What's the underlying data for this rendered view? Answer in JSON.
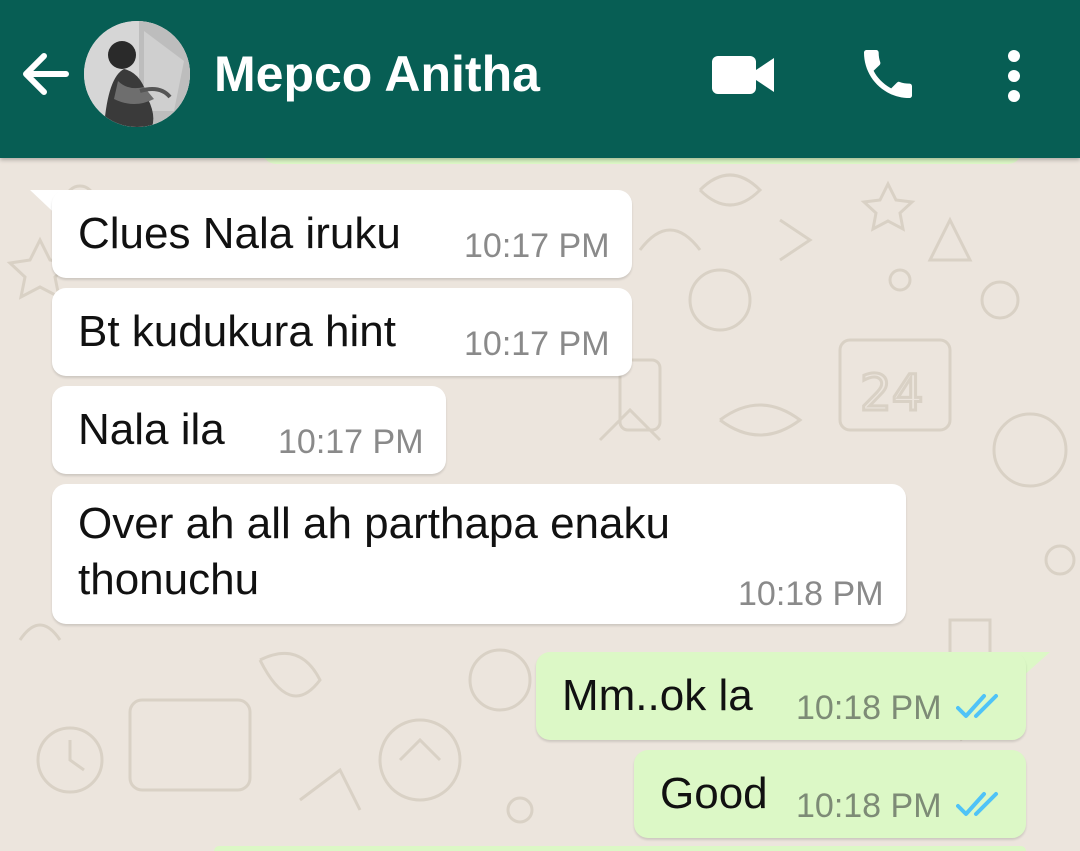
{
  "header": {
    "contact_name": "Mepco Anitha",
    "back_icon": "arrow-left-icon",
    "video_icon": "videocam-icon",
    "call_icon": "phone-icon",
    "menu_icon": "more-vert-icon",
    "background_color": "#075e54"
  },
  "messages": [
    {
      "direction": "incoming",
      "text": "Clues Nala iruku",
      "time": "10:17 PM"
    },
    {
      "direction": "incoming",
      "text": "Bt kudukura hint",
      "time": "10:17 PM"
    },
    {
      "direction": "incoming",
      "text": "Nala ila",
      "time": "10:17 PM"
    },
    {
      "direction": "incoming",
      "text_line1": "Over ah all ah parthapa enaku",
      "text_line2": "thonuchu",
      "time": "10:18 PM"
    },
    {
      "direction": "outgoing",
      "text": "Mm..ok la",
      "time": "10:18 PM",
      "status": "read"
    },
    {
      "direction": "outgoing",
      "text": "Good",
      "time": "10:18 PM",
      "status": "read"
    }
  ],
  "colors": {
    "incoming_bubble": "#ffffff",
    "outgoing_bubble": "#dcf8c6",
    "read_tick": "#4fc3f7",
    "wallpaper": "#ece5dd"
  }
}
